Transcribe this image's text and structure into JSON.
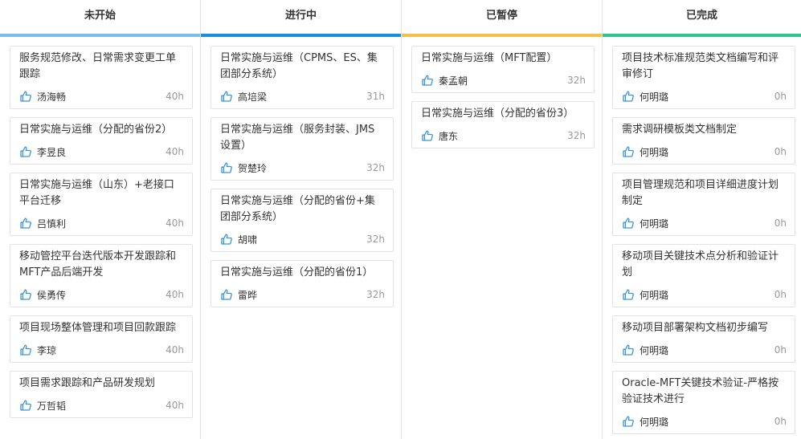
{
  "colors": {
    "not_started": "#7cbde9",
    "in_progress": "#1b8ce0",
    "paused": "#f2c14b",
    "done": "#2ec48d",
    "thumb_icon": "#3a94d6"
  },
  "columns": [
    {
      "title": "未开始",
      "cards": [
        {
          "title": "服务规范修改、日常需求变更工单跟踪",
          "person": "汤海畅",
          "hours": "40h"
        },
        {
          "title": "日常实施与运维（分配的省份2）",
          "person": "李昱良",
          "hours": "40h"
        },
        {
          "title": "日常实施与运维（山东）+老接口平台迁移",
          "person": "吕慎利",
          "hours": "40h"
        },
        {
          "title": "移动管控平台迭代版本开发跟踪和MFT产品后端开发",
          "person": "侯勇传",
          "hours": "40h"
        },
        {
          "title": "项目现场整体管理和项目回款跟踪",
          "person": "李琼",
          "hours": "40h"
        },
        {
          "title": "项目需求跟踪和产品研发规划",
          "person": "万哲韬",
          "hours": "40h"
        }
      ]
    },
    {
      "title": "进行中",
      "cards": [
        {
          "title": "日常实施与运维（CPMS、ES、集团部分系统）",
          "person": "高培梁",
          "hours": "31h"
        },
        {
          "title": "日常实施与运维（服务封装、JMS设置）",
          "person": "贺楚玲",
          "hours": "32h"
        },
        {
          "title": "日常实施与运维（分配的省份+集团部分系统）",
          "person": "胡啸",
          "hours": "32h"
        },
        {
          "title": "日常实施与运维（分配的省份1）",
          "person": "雷晔",
          "hours": "32h"
        }
      ]
    },
    {
      "title": "已暂停",
      "cards": [
        {
          "title": "日常实施与运维（MFT配置）",
          "person": "秦孟朝",
          "hours": "32h"
        },
        {
          "title": "日常实施与运维（分配的省份3）",
          "person": "唐东",
          "hours": "32h"
        }
      ]
    },
    {
      "title": "已完成",
      "cards": [
        {
          "title": "项目技术标准规范类文档编写和评审修订",
          "person": "何明璐",
          "hours": "0h"
        },
        {
          "title": "需求调研模板类文档制定",
          "person": "何明璐",
          "hours": "0h"
        },
        {
          "title": "项目管理规范和项目详细进度计划制定",
          "person": "何明璐",
          "hours": "0h"
        },
        {
          "title": "移动项目关键技术点分析和验证计划",
          "person": "何明璐",
          "hours": "0h"
        },
        {
          "title": "移动项目部署架构文档初步编写",
          "person": "何明璐",
          "hours": "0h"
        },
        {
          "title": "Oracle-MFT关键技术验证-严格按验证技术进行",
          "person": "何明璐",
          "hours": "0h"
        }
      ]
    }
  ]
}
